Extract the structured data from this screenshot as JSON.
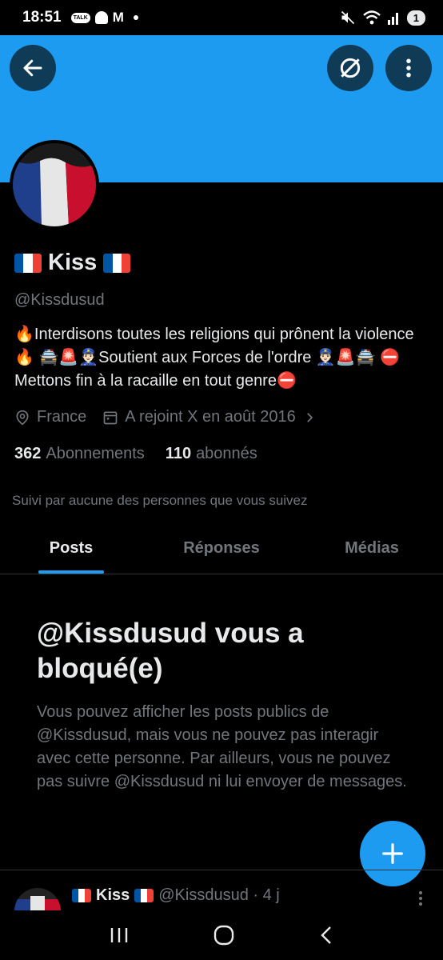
{
  "status_bar": {
    "time": "18:51",
    "talk_badge": "TALK",
    "mail_icon": "M",
    "battery": "1"
  },
  "profile": {
    "name": "Kiss",
    "handle": "@Kissdusud",
    "bio": "🔥Interdisons toutes les religions qui prônent la violence 🔥 🚔🚨👮🏻‍♂️Soutient aux Forces de l'ordre 👮🏻‍♂️🚨🚔 ⛔Mettons fin à la racaille en tout genre⛔",
    "location": "France",
    "joined": "A rejoint X en août 2016",
    "following_count": "362",
    "following_label": "Abonnements",
    "followers_count": "110",
    "followers_label": "abonnés",
    "followed_by": "Suivi par aucune des personnes que vous suivez"
  },
  "tabs": [
    {
      "label": "Posts",
      "active": true
    },
    {
      "label": "Réponses",
      "active": false
    },
    {
      "label": "Médias",
      "active": false
    }
  ],
  "blocked": {
    "title": "@Kissdusud vous a bloqué(e)",
    "text": "Vous pouvez afficher les posts publics de @Kissdusud, mais vous ne pouvez pas interagir avec cette personne. Par ailleurs, vous ne pouvez pas suivre @Kissdusud ni lui envoyer de messages."
  },
  "post_preview": {
    "name": "Kiss",
    "handle_time": "@Kissdusud · 4 j"
  },
  "icons": {
    "back": "arrow-left-icon",
    "grok": "grok-icon",
    "more": "more-vertical-icon",
    "location": "location-pin-icon",
    "calendar": "calendar-icon",
    "compose": "plus-icon"
  },
  "colors": {
    "accent": "#1d9bf0",
    "background": "#000000",
    "muted_text": "#71767b",
    "primary_text": "#e7e9ea"
  }
}
